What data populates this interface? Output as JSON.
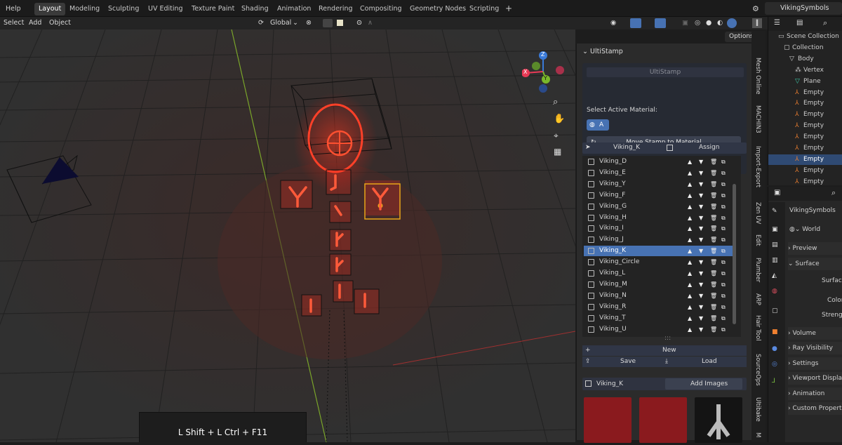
{
  "menu": {
    "help": "Help",
    "tabs": [
      "Layout",
      "Modeling",
      "Sculpting",
      "UV Editing",
      "Texture Paint",
      "Shading",
      "Animation",
      "Rendering",
      "Compositing",
      "Geometry Nodes",
      "Scripting"
    ],
    "add_tab": "+",
    "scene": "VikingSymbols"
  },
  "header": {
    "select": "Select",
    "add": "Add",
    "object": "Object",
    "orientation": "Global",
    "options": "Options"
  },
  "viewport": {
    "shortcut": "L Shift + L Ctrl + F11",
    "gizmo": {
      "z": "Z",
      "y": "Y",
      "x": "X"
    }
  },
  "ultistamp": {
    "title": "UltiStamp",
    "button": "UltiStamp",
    "select_label": "Select Active Material:",
    "material_btn": "A",
    "move_btn": "Move Stamp to Material",
    "active_name": "Viking_K",
    "assign": "Assign",
    "items": [
      "Viking_D",
      "Viking_E",
      "Viking_Y",
      "Viking_F",
      "Viking_G",
      "Viking_H",
      "Viking_I",
      "Viking_J",
      "Viking_K",
      "Viking_Circle",
      "Viking_L",
      "Viking_M",
      "Viking_N",
      "Viking_R",
      "Viking_T",
      "Viking_U"
    ],
    "selected_index": 8,
    "new": "New",
    "save": "Save",
    "load": "Load",
    "images_name": "Viking_K",
    "add_images": "Add Images",
    "more": ":::"
  },
  "side_tabs": [
    "Mesh Online",
    "MACHIN3",
    "Import-Export",
    "Zen UV",
    "Edit",
    "Plumber",
    "ARP",
    "Hair Tool",
    "SourceOps",
    "Ultibake",
    "M"
  ],
  "outliner": {
    "items": [
      "Scene Collection",
      "Collection",
      "Body",
      "Vertex",
      "Plane",
      "Empty",
      "Empty",
      "Empty",
      "Empty",
      "Empty",
      "Empty",
      "Empty",
      "Empty",
      "Empty"
    ],
    "selected_index": 11
  },
  "properties": {
    "object": "VikingSymbols",
    "world": "World",
    "sections": [
      "Preview",
      "Surface",
      "Surface",
      "Color",
      "Strength",
      "Volume",
      "Ray Visibility",
      "Settings",
      "Viewport Display",
      "Animation",
      "Custom Properties"
    ]
  }
}
